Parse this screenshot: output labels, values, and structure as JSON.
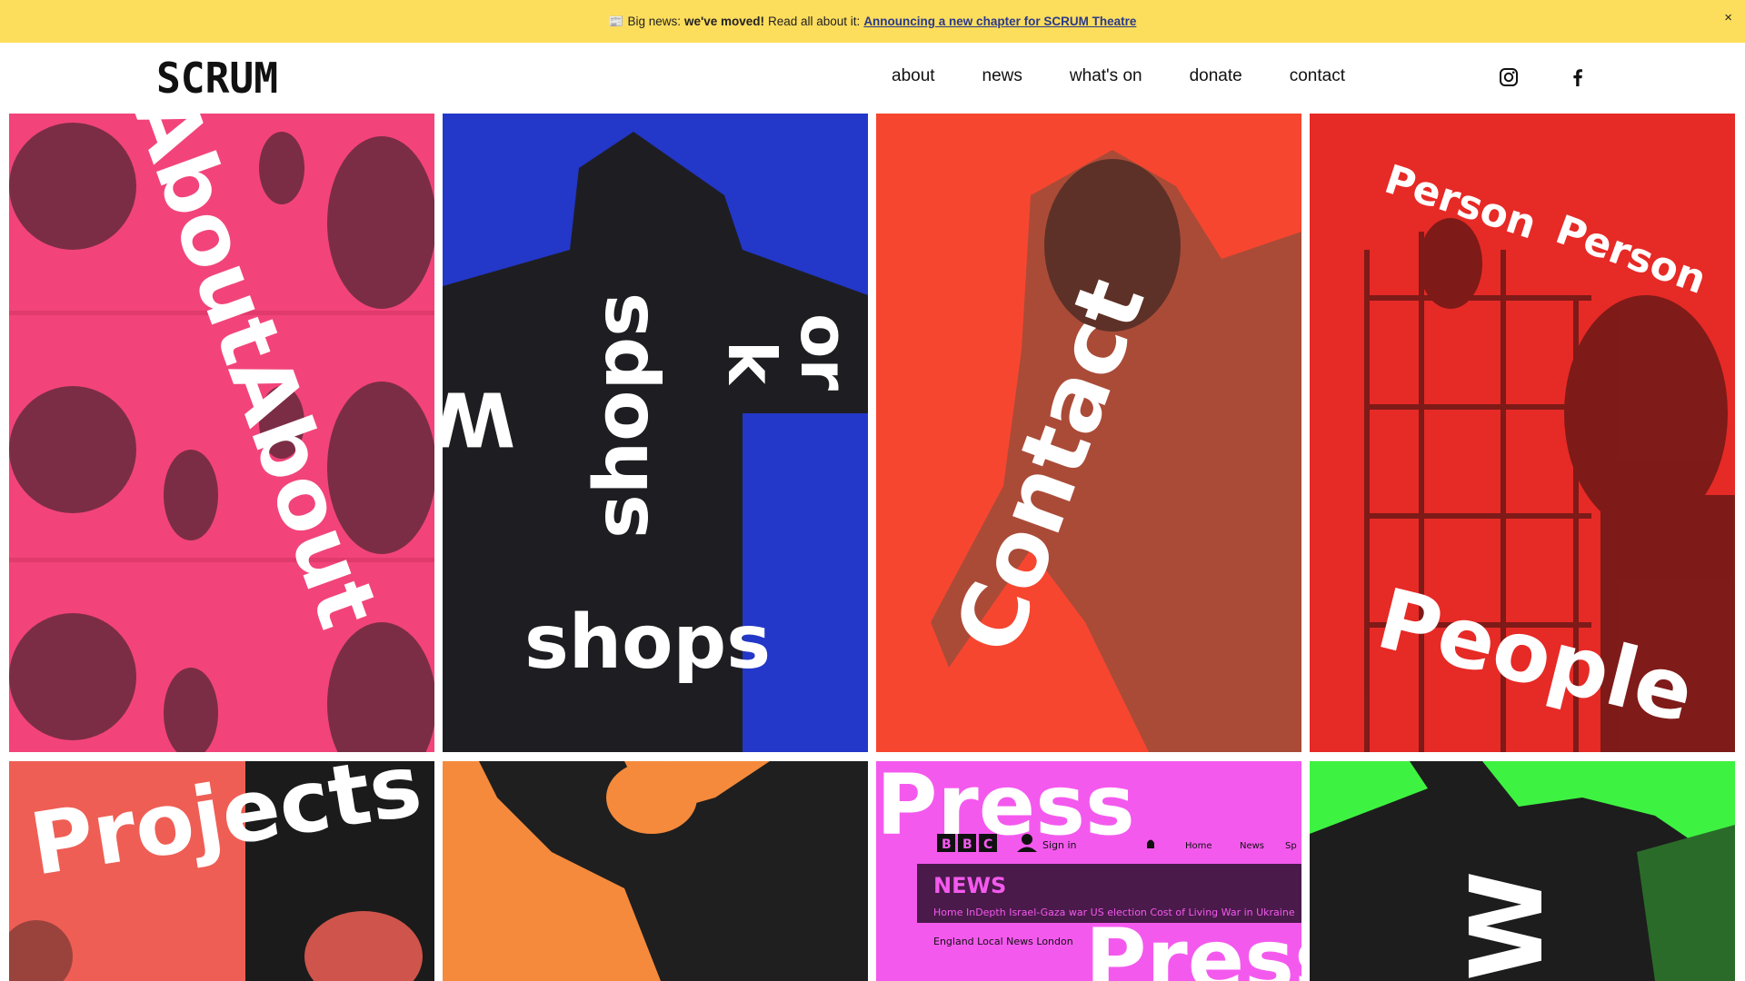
{
  "banner": {
    "emoji": "📰",
    "prefix": "Big news:",
    "strong": "we've moved!",
    "middle": "Read all about it:",
    "link_text": "Announcing a new chapter for SCRUM Theatre",
    "close_label": "×"
  },
  "header": {
    "logo_text": "SCRUM",
    "nav": [
      "about",
      "news",
      "what's on",
      "donate",
      "contact"
    ],
    "social": [
      "instagram-icon",
      "facebook-icon"
    ]
  },
  "tiles": {
    "about": {
      "text": "AboutAbout",
      "color": "#f2447a"
    },
    "workshops": {
      "big": "shops",
      "vert_left": "Work",
      "vert_right": "shops",
      "vert_far": "or",
      "vert_k": "k",
      "color": "#2337c8"
    },
    "contact": {
      "text": "Contact",
      "color": "#f7462f"
    },
    "people": {
      "text1": "Person",
      "text2": "Person",
      "text3": "People",
      "color": "#e62a26"
    },
    "projects": {
      "text": "Projects",
      "color": "#ef5e54"
    },
    "whats_on": {
      "color": "#f58a3c"
    },
    "press": {
      "text1": "Press",
      "text2": "Press",
      "news_brand": "BBC",
      "sign_in": "Sign in",
      "news_label": "NEWS",
      "nav_home": "Home",
      "nav_news": "News",
      "nav_sport": "Sp",
      "subnav": "Home   InDepth   Israel-Gaza war   US election   Cost of Living   War in Ukraine",
      "regions": "England   Local News   London",
      "color": "#f459ee"
    },
    "green": {
      "text": "W",
      "color": "#3ef241"
    }
  }
}
